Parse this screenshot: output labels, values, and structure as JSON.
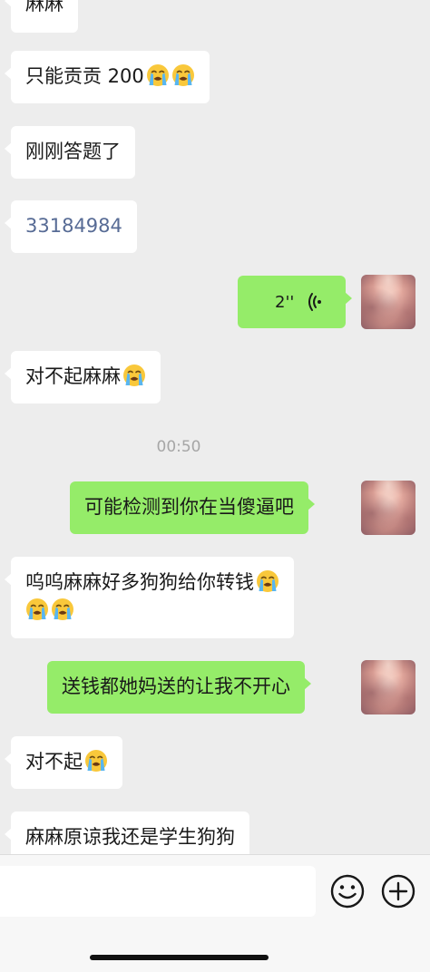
{
  "messages": [
    {
      "text": "麻麻"
    },
    {
      "text": "只能贡贡 200"
    },
    {
      "text": "刚刚答题了"
    },
    {
      "text": "33184984"
    },
    {
      "voice_duration": "2''"
    },
    {
      "text": "对不起麻麻"
    },
    {
      "text": "可能检测到你在当傻逼吧"
    },
    {
      "line1": "呜呜麻麻好多狗狗给你转钱"
    },
    {
      "text": "送钱都她妈送的让我不开心"
    },
    {
      "text": "对不起"
    },
    {
      "text": "麻麻原谅我还是学生狗狗"
    }
  ],
  "timestamp": "00:50",
  "icons": {
    "crying": "loudly-crying-face-emoji",
    "voice": "voice-wave-icon",
    "emoji_button": "smiley-face-icon",
    "plus_button": "plus-circle-icon"
  },
  "colors": {
    "background": "#ededed",
    "incoming_bubble": "#ffffff",
    "outgoing_bubble": "#95ec69",
    "link": "#576b95",
    "timestamp": "#a6a6a6"
  }
}
